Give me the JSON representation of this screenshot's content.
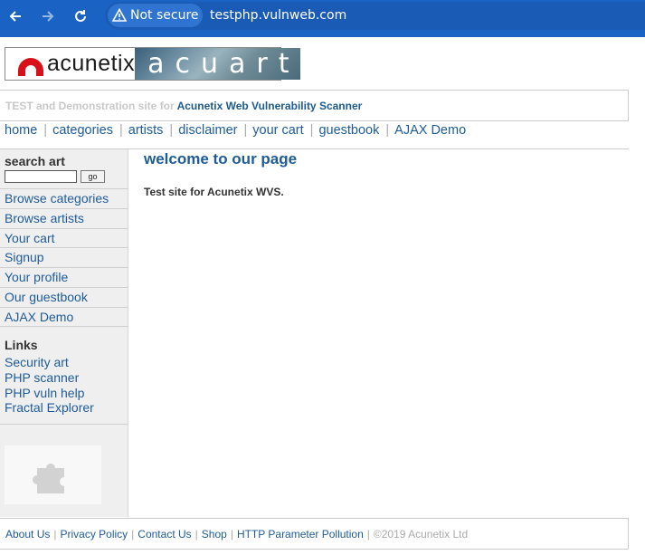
{
  "browser": {
    "security_label": "Not secure",
    "url": "testphp.vulnweb.com"
  },
  "logo": {
    "left_text": "acunetix",
    "right_text": "acuart"
  },
  "tagline": {
    "prefix": "TEST and Demonstration site for",
    "link": "Acunetix Web Vulnerability Scanner"
  },
  "topnav": {
    "items": [
      "home",
      "categories",
      "artists",
      "disclaimer",
      "your cart",
      "guestbook",
      "AJAX Demo"
    ]
  },
  "sidebar": {
    "search_title": "search art",
    "search_value": "",
    "go_label": "go",
    "menu": [
      "Browse categories",
      "Browse artists",
      "Your cart",
      "Signup",
      "Your profile",
      "Our guestbook",
      "AJAX Demo"
    ],
    "links_title": "Links",
    "links": [
      "Security art",
      "PHP scanner",
      "PHP vuln help",
      "Fractal Explorer"
    ],
    "plugin_icon": "puzzle-icon"
  },
  "content": {
    "title": "welcome to our page",
    "text": "Test site for Acunetix WVS."
  },
  "footer": {
    "links": [
      "About Us",
      "Privacy Policy",
      "Contact Us",
      "Shop",
      "HTTP Parameter Pollution"
    ],
    "copyright": "©2019 Acunetix Ltd"
  }
}
